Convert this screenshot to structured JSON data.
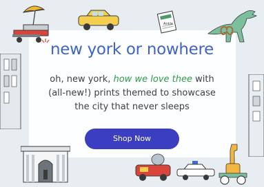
{
  "promo": {
    "headline": "new york or nowhere",
    "body_line1_start": "oh, new york, ",
    "body_line1_emphasis": "how we love thee",
    "body_line1_end": " with",
    "body_line2": "(all-new!) prints themed to showcase",
    "body_line3": "the city that never sleeps",
    "cta_label": "Shop Now"
  },
  "illustrations": {
    "newspaper_text": "Ankle",
    "icons": [
      "hot-dog-cart-icon",
      "taxi-cab-icon",
      "newspaper-icon",
      "dinosaur-icon",
      "pretzel-icon",
      "building-icon",
      "arch-monument-icon",
      "giraffe-icon",
      "police-car-icon"
    ]
  },
  "colors": {
    "headline": "#3f63c7",
    "emphasis": "#2f9a4a",
    "button": "#3b3ec0",
    "background": "#e7edf1"
  }
}
